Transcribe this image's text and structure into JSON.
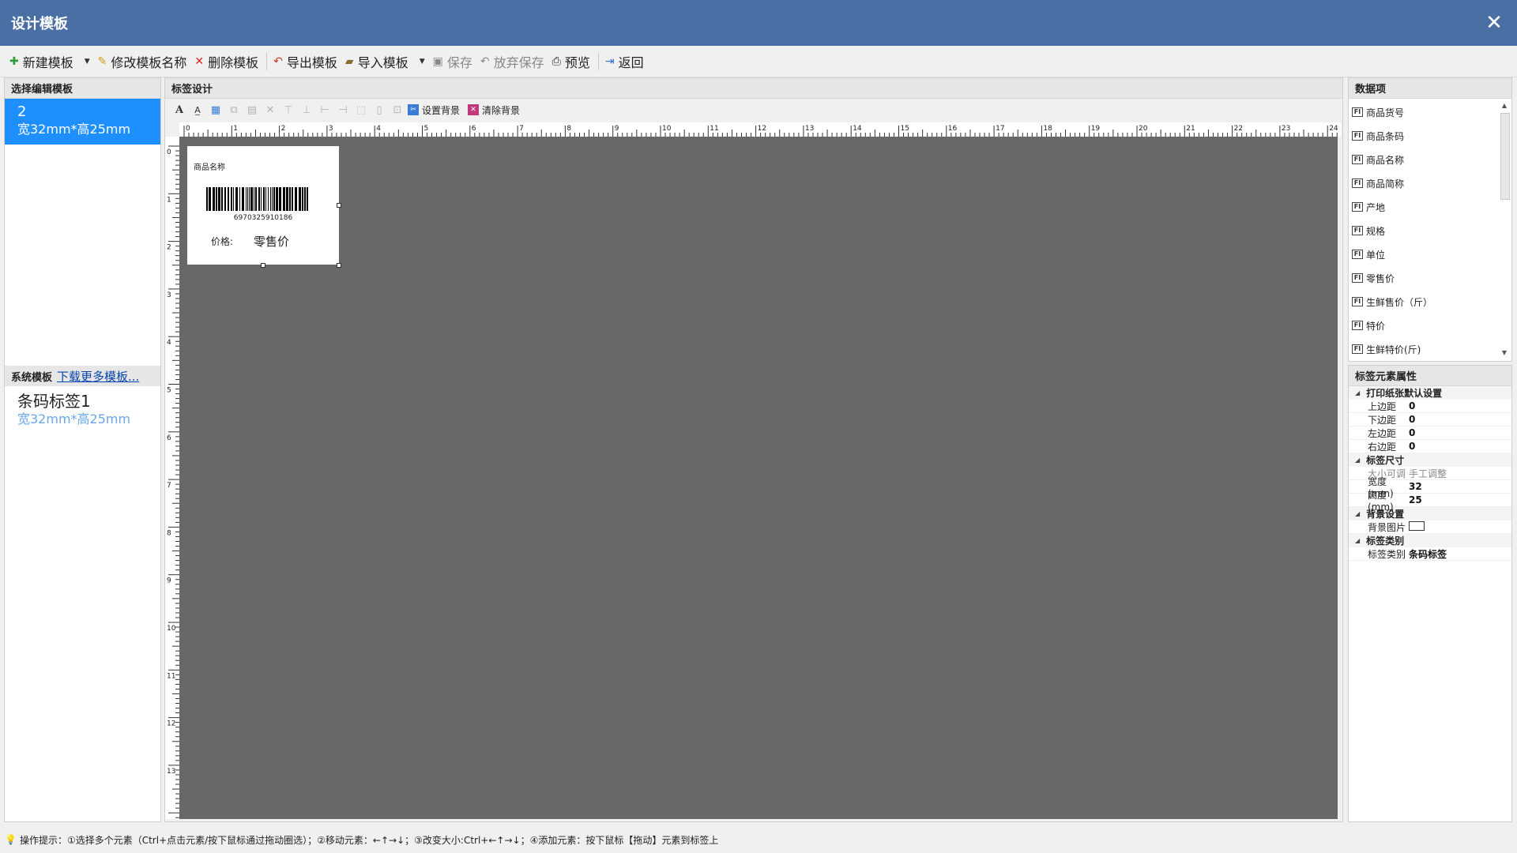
{
  "window": {
    "title": "设计模板"
  },
  "toolbar": {
    "new": "新建模板",
    "rename": "修改模板名称",
    "delete": "删除模板",
    "export": "导出模板",
    "import": "导入模板",
    "save": "保存",
    "discard": "放弃保存",
    "preview": "预览",
    "back": "返回"
  },
  "left": {
    "header": "选择编辑模板",
    "selected": {
      "number": "2",
      "size": "宽32mm*高25mm"
    },
    "system_header": "系统模板",
    "download_link": "下载更多模板...",
    "system_item": {
      "name": "条码标签1",
      "size": "宽32mm*高25mm"
    }
  },
  "center": {
    "header": "标签设计",
    "set_bg": "设置背景",
    "clear_bg": "清除背景",
    "ruler_h": [
      "0",
      "1",
      "2",
      "3",
      "4",
      "5",
      "6",
      "7",
      "8",
      "9",
      "10",
      "11",
      "12",
      "13",
      "14",
      "15",
      "16",
      "17",
      "18",
      "19",
      "20",
      "21",
      "22",
      "23",
      "24"
    ],
    "ruler_v": [
      "0",
      "1",
      "2",
      "3",
      "4",
      "5",
      "6",
      "7",
      "8",
      "9",
      "10",
      "11",
      "12",
      "13"
    ],
    "label": {
      "name": "商品名称",
      "barcode": "6970325910186",
      "price_label": "价格:",
      "price_value": "零售价"
    }
  },
  "data_items": {
    "header": "数据项",
    "icon_text": "FI",
    "items": [
      "商品货号",
      "商品条码",
      "商品名称",
      "商品简称",
      "产地",
      "规格",
      "单位",
      "零售价",
      "生鲜售价（斤）",
      "特价",
      "生鲜特价(斤)"
    ]
  },
  "props": {
    "header": "标签元素属性",
    "g1": "打印纸张默认设置",
    "top_k": "上边距",
    "top_v": "0",
    "bottom_k": "下边距",
    "bottom_v": "0",
    "left_k": "左边距",
    "left_v": "0",
    "right_k": "右边距",
    "right_v": "0",
    "g2": "标签尺寸",
    "size_mode_k": "大小可调",
    "size_mode_v": "手工调整",
    "width_k": "宽度(mm)",
    "width_v": "32",
    "height_k": "高度(mm)",
    "height_v": "25",
    "g3": "背景设置",
    "bgimg_k": "背景图片",
    "g4": "标签类别",
    "type_k": "标签类别",
    "type_v": "条码标签"
  },
  "status": {
    "text": "操作提示：①选择多个元素（Ctrl+点击元素/按下鼠标通过拖动圈选）；②移动元素：←↑→↓；③改变大小:Ctrl+←↑→↓；④添加元素：按下鼠标【拖动】元素到标签上"
  },
  "colors": {
    "titlebar": "#4a6fa5",
    "selected": "#1e8fff",
    "canvas": "#686868"
  }
}
